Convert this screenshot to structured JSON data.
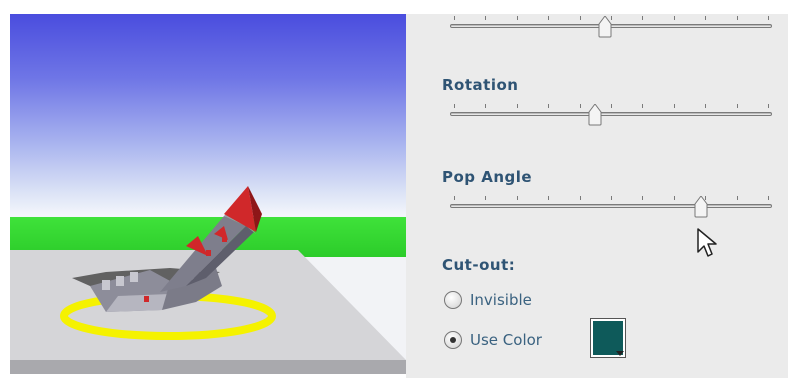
{
  "panel": {
    "sliders": [
      {
        "id": "top",
        "value_fraction": 0.48
      },
      {
        "id": "rotation",
        "label": "Rotation",
        "value_fraction": 0.45
      },
      {
        "id": "pop_angle",
        "label": "Pop Angle",
        "value_fraction": 0.78
      }
    ],
    "cutout": {
      "label": "Cut-out:",
      "options": [
        {
          "label": "Invisible",
          "selected": false
        },
        {
          "label": "Use Color",
          "selected": true
        }
      ],
      "color": "#0e5a5a"
    }
  },
  "colors": {
    "label_text": "#2f5474",
    "panel_bg": "#ebebeb",
    "ring": "#f5f200",
    "castle_roof": "#d0282a",
    "castle_wall": "#8d8d9a"
  },
  "icons": {
    "cursor": "pointer-cursor-icon"
  }
}
